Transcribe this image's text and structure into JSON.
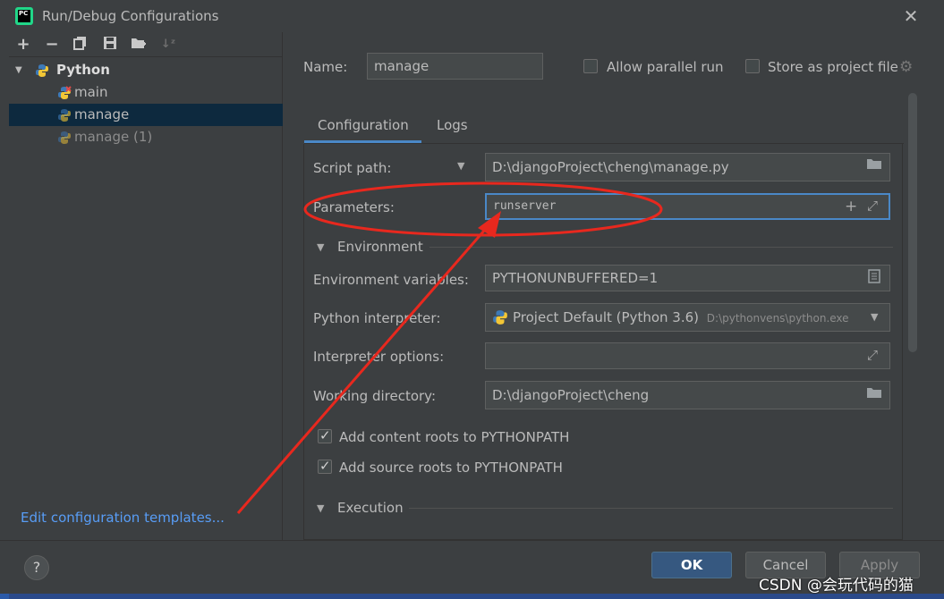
{
  "window": {
    "title": "Run/Debug Configurations",
    "app_icon_text": "PC"
  },
  "toolbar": {
    "icons": [
      "add-icon",
      "remove-icon",
      "copy-icon",
      "save-icon",
      "folder-add-icon",
      "sort-icon"
    ]
  },
  "tree": {
    "root": "Python",
    "items": [
      {
        "label": "main"
      },
      {
        "label": "manage"
      },
      {
        "label": "manage (1)"
      }
    ]
  },
  "edit_templates": "Edit configuration templates...",
  "name_label": "Name:",
  "name_value": "manage",
  "allow_parallel": {
    "label": "Allow parallel run",
    "checked": false
  },
  "store_project": {
    "label": "Store as project file",
    "checked": false
  },
  "tabs": [
    "Configuration",
    "Logs"
  ],
  "script_path": {
    "label": "Script path:",
    "value": "D:\\djangoProject\\cheng\\manage.py"
  },
  "parameters": {
    "label": "Parameters:",
    "value": "runserver"
  },
  "environment_section": "Environment",
  "env_vars": {
    "label": "Environment variables:",
    "value": "PYTHONUNBUFFERED=1"
  },
  "interpreter": {
    "label": "Python interpreter:",
    "value": "Project Default (Python 3.6)",
    "path": "D:\\pythonvens\\python.exe"
  },
  "interp_options": {
    "label": "Interpreter options:",
    "value": ""
  },
  "working_dir": {
    "label": "Working directory:",
    "value": "D:\\djangoProject\\cheng"
  },
  "content_roots": {
    "label": "Add content roots to PYTHONPATH",
    "checked": true
  },
  "source_roots": {
    "label": "Add source roots to PYTHONPATH",
    "checked": true
  },
  "execution_section": "Execution",
  "buttons": {
    "ok": "OK",
    "cancel": "Cancel",
    "apply": "Apply",
    "help": "?"
  },
  "watermark": "CSDN @会玩代码的猫",
  "colors": {
    "accent": "#4a88c7",
    "annotation": "#e8281e",
    "link": "#589df6"
  }
}
